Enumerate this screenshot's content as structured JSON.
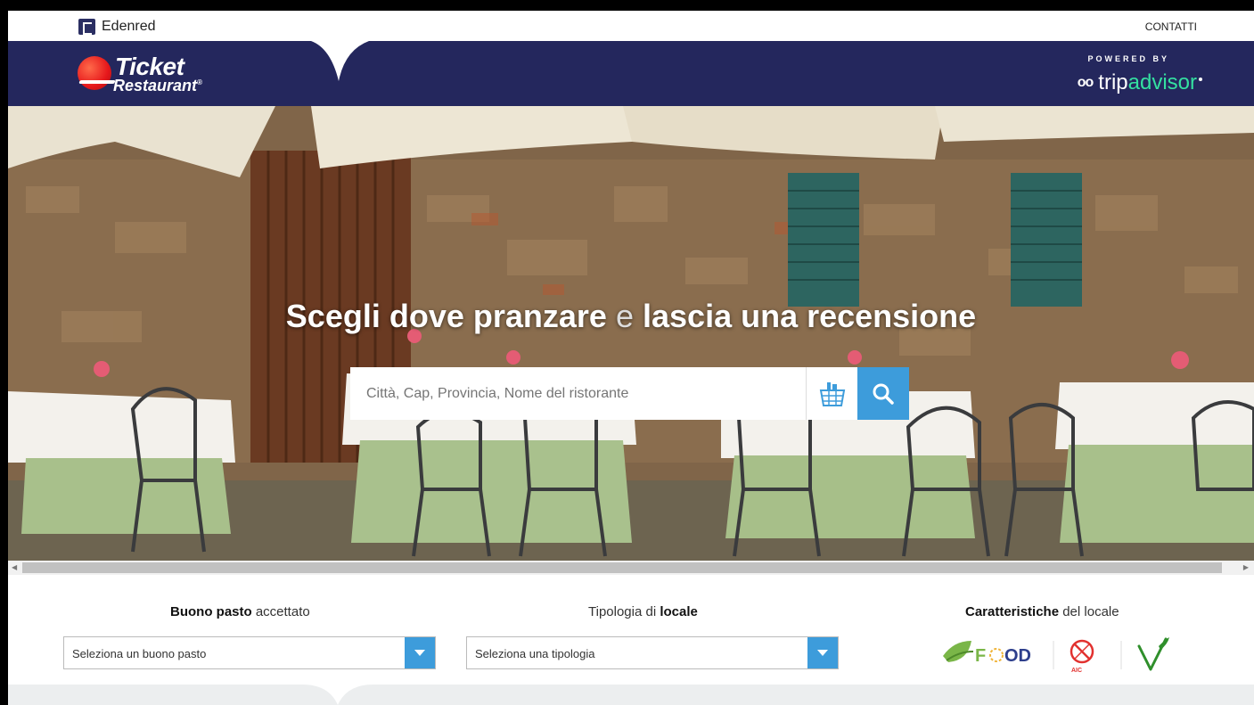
{
  "topbar": {
    "brand": "Edenred",
    "contact_link": "CONTATTI"
  },
  "header": {
    "logo_line1": "Ticket",
    "logo_line2": "Restaurant",
    "logo_reg": "®",
    "powered_by": "POWERED BY",
    "partner_prefix": "trip",
    "partner_suffix": "advisor",
    "partner_owl": "oo"
  },
  "hero": {
    "title_part1": "Scegli dove pranzare",
    "title_connector": "e",
    "title_part2": "lascia una recensione",
    "search_placeholder": "Città, Cap, Provincia, Nome del ristorante"
  },
  "filters": {
    "voucher_label_bold": "Buono pasto",
    "voucher_label_rest": "accettato",
    "voucher_select": "Seleziona un buono pasto",
    "type_label_pre": "Tipologia di",
    "type_label_bold": "locale",
    "type_select": "Seleziona una tipologia",
    "features_label_bold": "Caratteristiche",
    "features_label_rest": "del locale",
    "feature_icons": [
      "food-icon",
      "gluten-free-aic-icon",
      "vegan-icon"
    ]
  },
  "colors": {
    "navy": "#24275d",
    "accent_blue": "#3d9cdb",
    "tripadvisor_green": "#34e0a1",
    "logo_red": "#e6171b"
  }
}
